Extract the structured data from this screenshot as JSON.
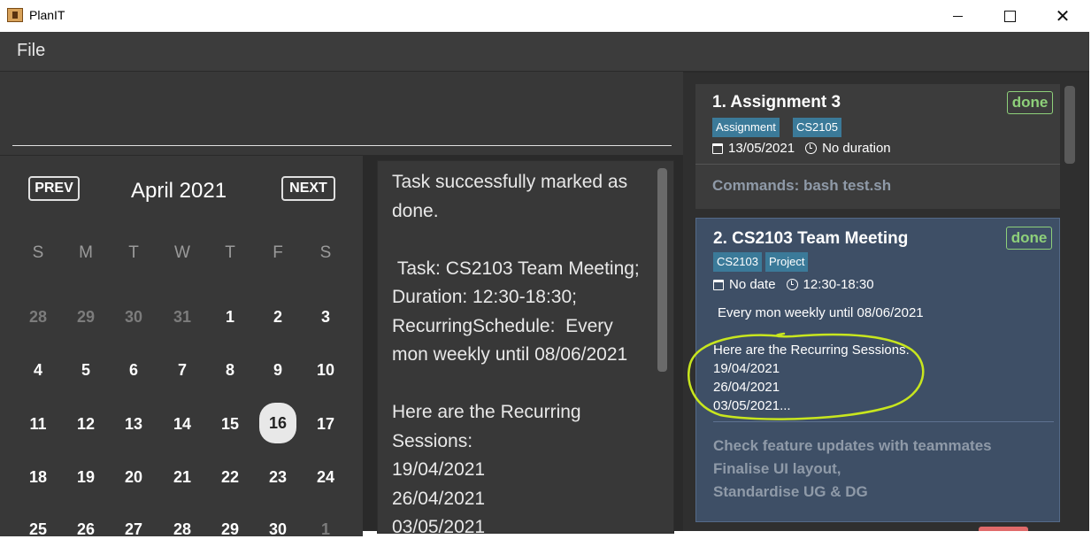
{
  "window": {
    "title": "PlanIT",
    "min_label": "",
    "max_label": "",
    "close_label": "✕"
  },
  "menu": {
    "file": "File"
  },
  "calendar": {
    "prev": "PREV",
    "next": "NEXT",
    "month": "April 2021",
    "weekdays": [
      "S",
      "M",
      "T",
      "W",
      "T",
      "F",
      "S"
    ],
    "weeks": [
      [
        "28",
        "29",
        "30",
        "31",
        "1",
        "2",
        "3"
      ],
      [
        "4",
        "5",
        "6",
        "7",
        "8",
        "9",
        "10"
      ],
      [
        "11",
        "12",
        "13",
        "14",
        "15",
        "16",
        "17"
      ],
      [
        "18",
        "19",
        "20",
        "21",
        "22",
        "23",
        "24"
      ],
      [
        "25",
        "26",
        "27",
        "28",
        "29",
        "30",
        "1"
      ]
    ],
    "today": "16"
  },
  "result": {
    "text": "Task successfully marked as done.\n\n Task: CS2103 Team Meeting; Duration: 12:30-18:30; RecurringSchedule:  Every mon weekly until 08/06/2021\n\nHere are the Recurring Sessions:\n19/04/2021\n26/04/2021\n03/05/2021"
  },
  "tasks": [
    {
      "index_title": "1.  Assignment 3",
      "status": "done",
      "tags": [
        "Assignment",
        "CS2105"
      ],
      "date": "13/05/2021",
      "duration": "No duration",
      "description": "Commands: bash test.sh"
    },
    {
      "index_title": "2.  CS2103 Team Meeting",
      "status": "done",
      "tags": [
        "CS2103",
        "Project"
      ],
      "date": "No date",
      "duration": "12:30-18:30",
      "recurrence": "Every mon weekly until 08/06/2021",
      "sessions": "Here are the Recurring Sessions:\n19/04/2021\n26/04/2021\n03/05/2021...",
      "description": "Check feature updates with teammates\nFinalise UI layout,\nStandardise UG & DG"
    }
  ]
}
